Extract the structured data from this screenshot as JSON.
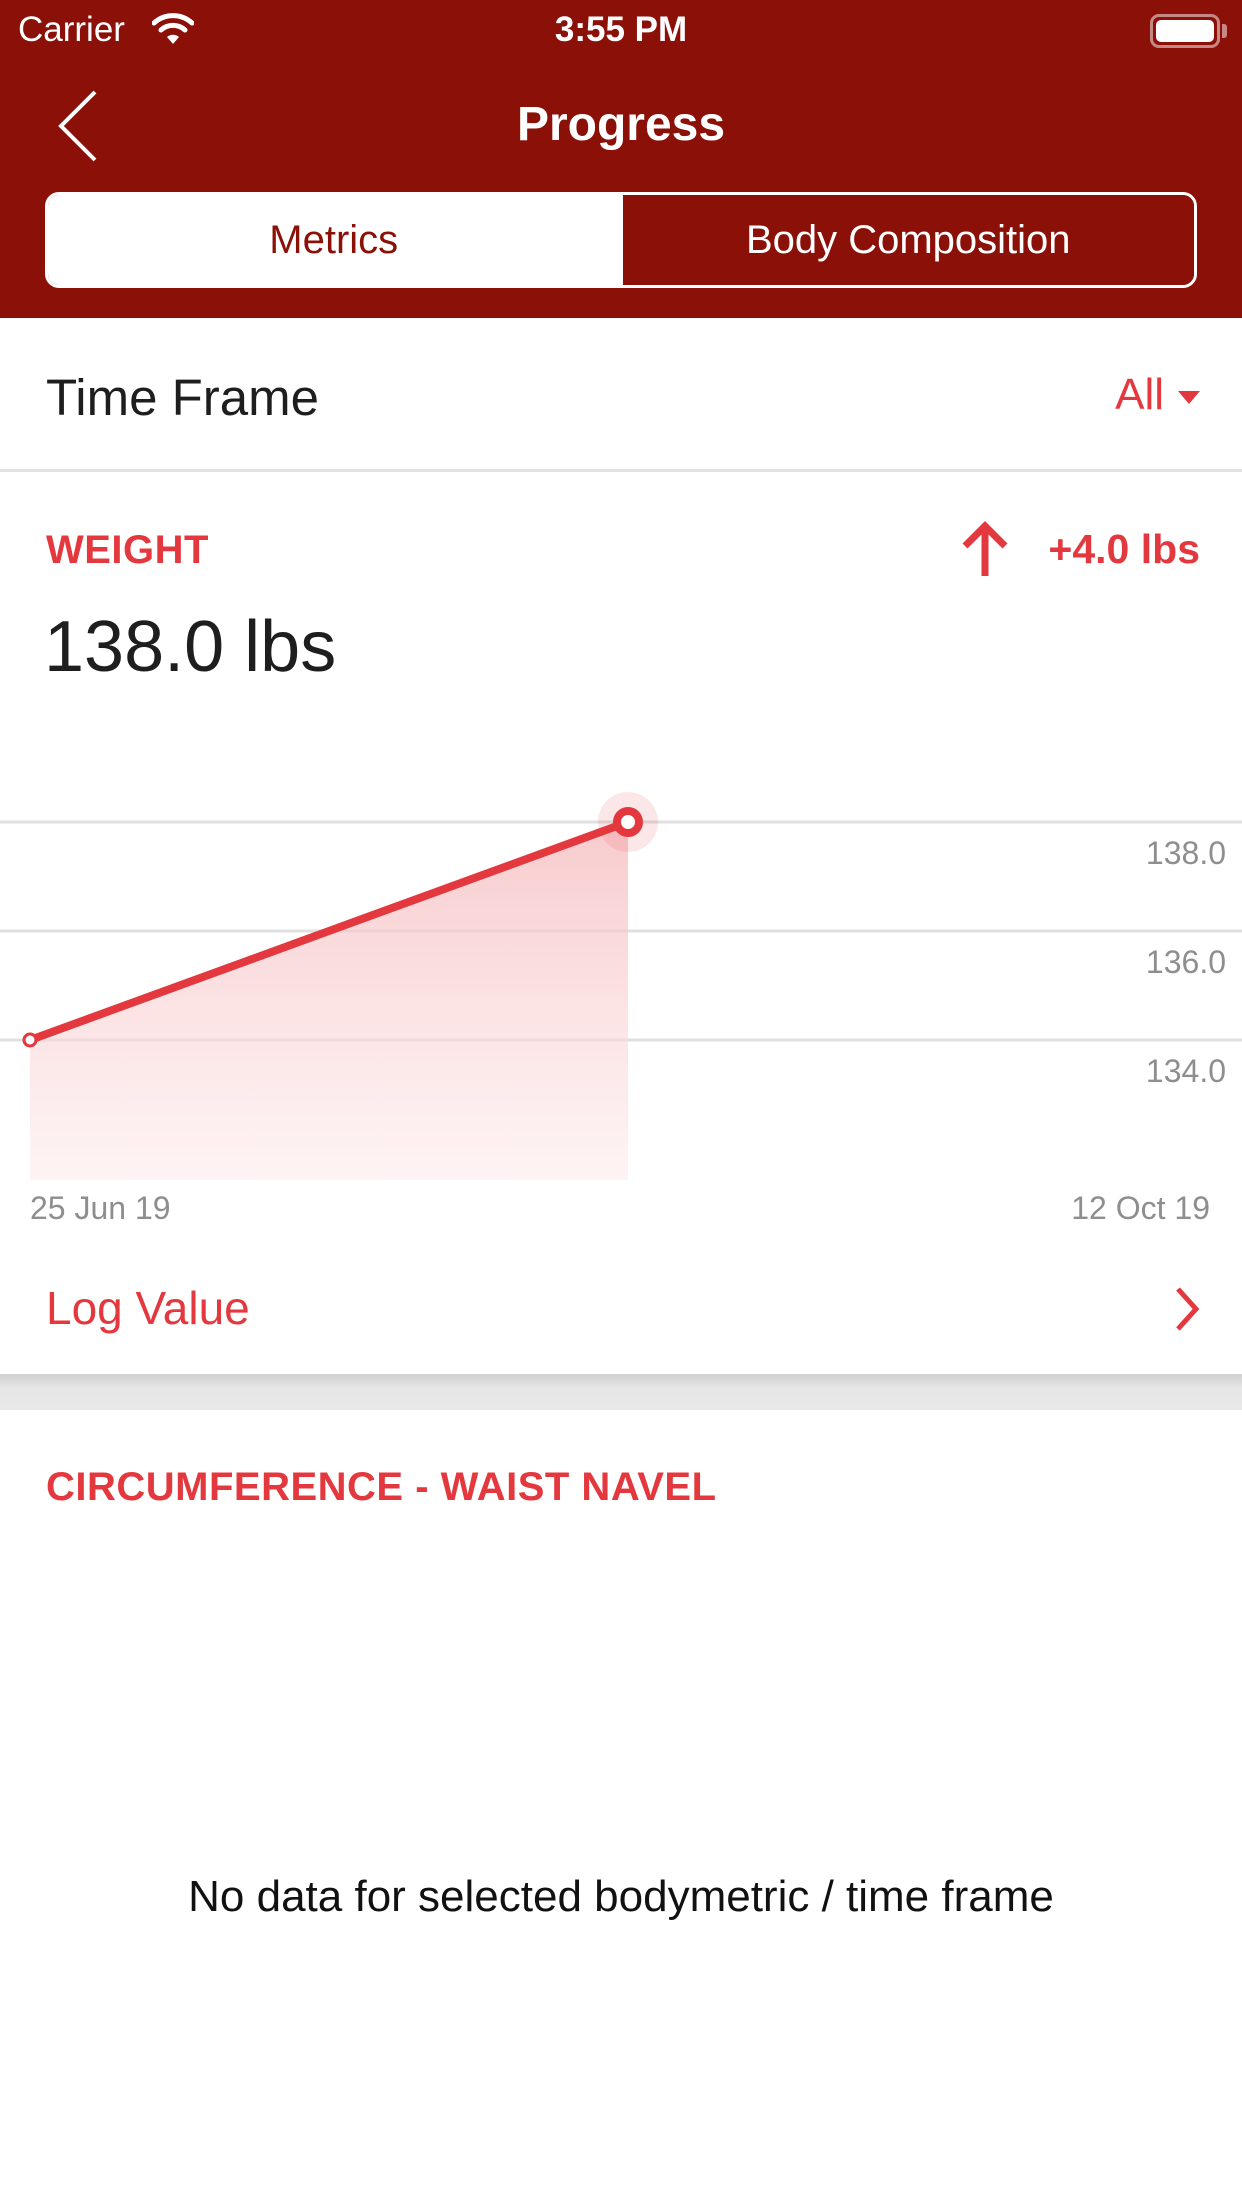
{
  "status_bar": {
    "carrier": "Carrier",
    "time": "3:55 PM",
    "wifi_icon": "wifi-icon",
    "battery_icon": "battery-icon",
    "battery_level_percent": 100
  },
  "nav": {
    "title": "Progress",
    "back_icon": "chevron-left-icon"
  },
  "tabs": [
    {
      "label": "Metrics",
      "selected": true
    },
    {
      "label": "Body Composition",
      "selected": false
    }
  ],
  "time_frame": {
    "label": "Time Frame",
    "value": "All",
    "icon": "caret-down-icon"
  },
  "weight_card": {
    "title": "WEIGHT",
    "current_value": "138.0 lbs",
    "change_icon": "arrow-up-icon",
    "change": "+4.0 lbs",
    "log_label": "Log Value",
    "log_icon": "chevron-right-icon"
  },
  "circumference_card": {
    "title": "CIRCUMFERENCE - WAIST NAVEL",
    "empty_message": "No data for selected bodymetric / time frame"
  },
  "colors": {
    "header": "#8b1108",
    "accent": "#e4383f",
    "text_dark": "#1e1e1e",
    "axis_text": "#8e8e8e",
    "gridline": "#e0e0e0"
  },
  "chart_data": {
    "type": "area",
    "title": "WEIGHT",
    "xlabel": "",
    "ylabel": "",
    "x_start_label": "25 Jun 19",
    "x_end_label": "12 Oct 19",
    "points": [
      {
        "date": "25 Jun 19",
        "value": 134.0
      },
      {
        "date": "latest",
        "value": 138.0
      }
    ],
    "y_ticks": [
      138.0,
      136.0,
      134.0
    ],
    "y_tick_labels": [
      "138.0",
      "136.0",
      "134.0"
    ],
    "ylim": [
      132.0,
      139.5
    ],
    "grid": true,
    "highlighted_point_index": 1,
    "legend": "none"
  }
}
